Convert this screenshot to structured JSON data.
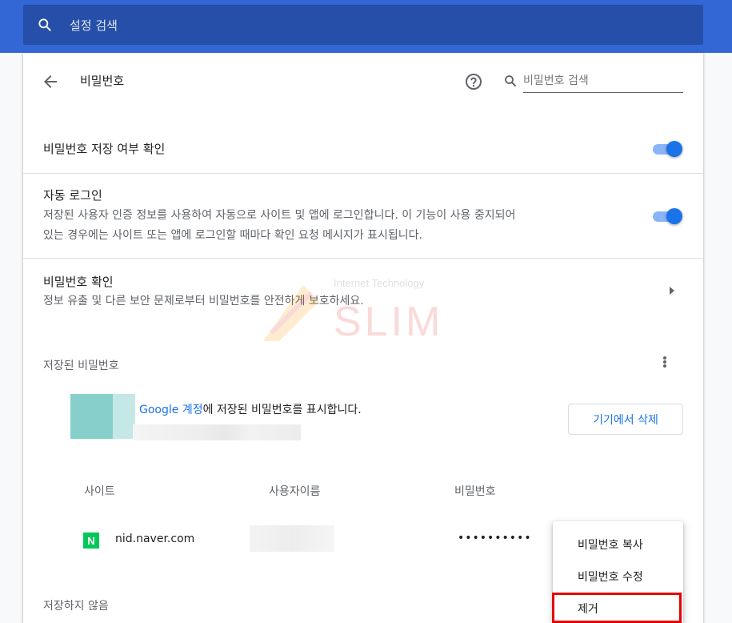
{
  "top_search": {
    "placeholder": "설정 검색",
    "icon": "search-icon"
  },
  "header": {
    "title": "비밀번호",
    "back_icon": "arrow-back-icon",
    "help_icon": "help-icon",
    "search_placeholder": "비밀번호 검색"
  },
  "settings": {
    "offer_save": {
      "label": "비밀번호 저장 여부 확인",
      "enabled": true
    },
    "auto_signin": {
      "label": "자동 로그인",
      "desc_line1": "저장된 사용자 인증 정보를 사용하여 자동으로 사이트 및 앱에 로그인합니다. 이 기능이 사용 중지되어",
      "desc_line2": "있는 경우에는 사이트 또는 앱에 로그인할 때마다 확인 요청 메시지가 표시됩니다.",
      "enabled": true
    },
    "check_passwords": {
      "label": "비밀번호 확인",
      "desc": "정보 유출 및 다른 보안 문제로부터 비밀번호를 안전하게 보호하세요."
    }
  },
  "watermark": {
    "brand": "SLIM",
    "tag": "Internet Technology"
  },
  "saved": {
    "title": "저장된 비밀번호",
    "banner_link": "Google 계정",
    "banner_text": "에 저장된 비밀번호를 표시합니다.",
    "delete_button": "기기에서 삭제",
    "columns": {
      "site": "사이트",
      "username": "사용자이름",
      "password": "비밀번호"
    },
    "rows": [
      {
        "favicon": "N",
        "site": "nid.naver.com",
        "password_mask": "••••••••••"
      }
    ]
  },
  "context_menu": {
    "items": [
      "비밀번호 복사",
      "비밀번호 수정",
      "제거"
    ],
    "highlighted": "제거",
    "highlight_color": "#e60000"
  },
  "never_saved": {
    "title": "저장하지 않음"
  },
  "colors": {
    "topbar": "#3367d6",
    "accent": "#1a73e8",
    "naver": "#03c75a"
  }
}
